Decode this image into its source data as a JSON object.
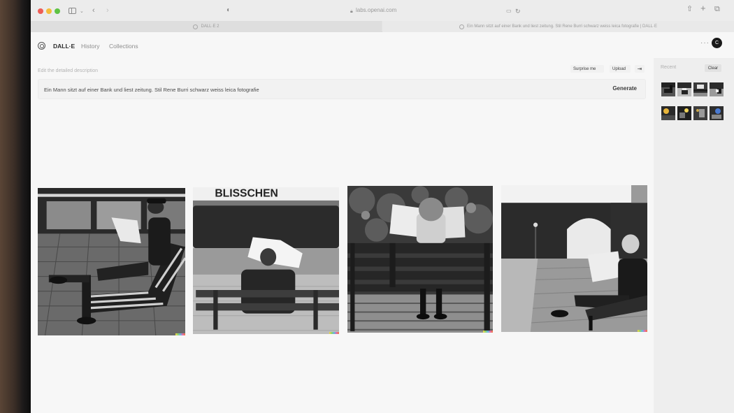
{
  "browser": {
    "url": "labs.openai.com",
    "tabs": [
      {
        "label": "DALL·E 2"
      },
      {
        "label": "Ein Mann sitzt auf einer Bank und liest zeitung. Stil Rene Burri schwarz weiss leica fotografie | DALL·E"
      }
    ]
  },
  "header": {
    "brand": "DALL·E",
    "nav": [
      "History",
      "Collections"
    ],
    "avatar_initial": "C"
  },
  "editor": {
    "label": "Edit the detailed description",
    "surprise_label": "Surprise me",
    "upload_label": "Upload",
    "prompt": "Ein Mann sitzt auf einer Bank und liest zeitung. Stil Rene Burri schwarz weiss leica fotografie",
    "generate_label": "Generate"
  },
  "recent": {
    "label": "Recent",
    "clear_label": "Clear"
  },
  "results": {
    "image_2_sign": "BLISSCHEN"
  }
}
